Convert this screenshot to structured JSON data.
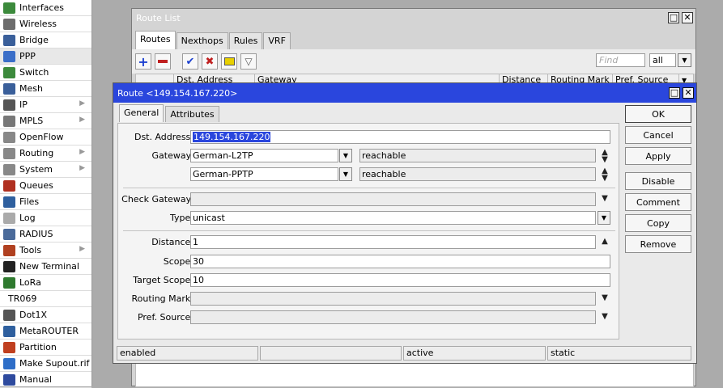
{
  "sidebar": {
    "items": [
      {
        "label": "Interfaces",
        "icon": "interfaces-icon",
        "color": "#3c8a3c",
        "submenu": false
      },
      {
        "label": "Wireless",
        "icon": "wireless-icon",
        "color": "#6c6c6c",
        "submenu": false
      },
      {
        "label": "Bridge",
        "icon": "bridge-icon",
        "color": "#3a5f9a",
        "submenu": false
      },
      {
        "label": "PPP",
        "icon": "ppp-icon",
        "color": "#3a6ec8",
        "submenu": false,
        "selected": true
      },
      {
        "label": "Switch",
        "icon": "switch-icon",
        "color": "#3c8a3c",
        "submenu": false
      },
      {
        "label": "Mesh",
        "icon": "mesh-icon",
        "color": "#3a5f9a",
        "submenu": false
      },
      {
        "label": "IP",
        "icon": "ip-icon",
        "color": "#555555",
        "submenu": true
      },
      {
        "label": "MPLS",
        "icon": "mpls-icon",
        "color": "#777777",
        "submenu": true
      },
      {
        "label": "OpenFlow",
        "icon": "openflow-icon",
        "color": "#888888",
        "submenu": false
      },
      {
        "label": "Routing",
        "icon": "routing-icon",
        "color": "#888888",
        "submenu": true
      },
      {
        "label": "System",
        "icon": "system-icon",
        "color": "#888888",
        "submenu": true
      },
      {
        "label": "Queues",
        "icon": "queues-icon",
        "color": "#b03020",
        "submenu": false
      },
      {
        "label": "Files",
        "icon": "files-icon",
        "color": "#2e5f9e",
        "submenu": false
      },
      {
        "label": "Log",
        "icon": "log-icon",
        "color": "#aaaaaa",
        "submenu": false
      },
      {
        "label": "RADIUS",
        "icon": "radius-icon",
        "color": "#4a6a9a",
        "submenu": false
      },
      {
        "label": "Tools",
        "icon": "tools-icon",
        "color": "#b04020",
        "submenu": true
      },
      {
        "label": "New Terminal",
        "icon": "terminal-icon",
        "color": "#222222",
        "submenu": false
      },
      {
        "label": "LoRa",
        "icon": "lora-icon",
        "color": "#2f7a2f",
        "submenu": false
      },
      {
        "label": "TR069",
        "icon": "",
        "color": "",
        "submenu": false
      },
      {
        "label": "Dot1X",
        "icon": "dot1x-icon",
        "color": "#555555",
        "submenu": false
      },
      {
        "label": "MetaROUTER",
        "icon": "metarouter-icon",
        "color": "#2e5f9e",
        "submenu": false
      },
      {
        "label": "Partition",
        "icon": "partition-icon",
        "color": "#c04020",
        "submenu": false
      },
      {
        "label": "Make Supout.rif",
        "icon": "supout-icon",
        "color": "#2e6ec8",
        "submenu": false
      },
      {
        "label": "Manual",
        "icon": "manual-icon",
        "color": "#2e4a9e",
        "submenu": false
      }
    ]
  },
  "route_list": {
    "title": "Route List",
    "tabs": [
      "Routes",
      "Nexthops",
      "Rules",
      "VRF"
    ],
    "find_placeholder": "Find",
    "filter_value": "all",
    "columns": [
      "Dst. Address",
      "Gateway",
      "Distance",
      "Routing Mark",
      "Pref. Source"
    ]
  },
  "dialog": {
    "title": "Route <149.154.167.220>",
    "tabs": [
      "General",
      "Attributes"
    ],
    "fields": {
      "dst_address": {
        "label": "Dst. Address:",
        "value": "149.154.167.220"
      },
      "gateway": {
        "label": "Gateway:",
        "value1": "German-L2TP",
        "status1": "reachable",
        "value2": "German-PPTP",
        "status2": "reachable"
      },
      "check_gateway": {
        "label": "Check Gateway:",
        "value": ""
      },
      "type": {
        "label": "Type:",
        "value": "unicast"
      },
      "distance": {
        "label": "Distance:",
        "value": "1"
      },
      "scope": {
        "label": "Scope:",
        "value": "30"
      },
      "target_scope": {
        "label": "Target Scope:",
        "value": "10"
      },
      "routing_mark": {
        "label": "Routing Mark:",
        "value": ""
      },
      "pref_source": {
        "label": "Pref. Source:",
        "value": ""
      }
    },
    "buttons": {
      "ok": "OK",
      "cancel": "Cancel",
      "apply": "Apply",
      "disable": "Disable",
      "comment": "Comment",
      "copy": "Copy",
      "remove": "Remove"
    },
    "status": {
      "state": "enabled",
      "blank": "",
      "activity": "active",
      "kind": "static"
    }
  },
  "colors": {
    "dialog_title": "#2a46dd",
    "selection": "#2a46dd",
    "add": "#1a3fd0",
    "remove": "#c02020",
    "enable": "#1a3fd0",
    "disable": "#c02020",
    "comment": "#e8d000"
  }
}
